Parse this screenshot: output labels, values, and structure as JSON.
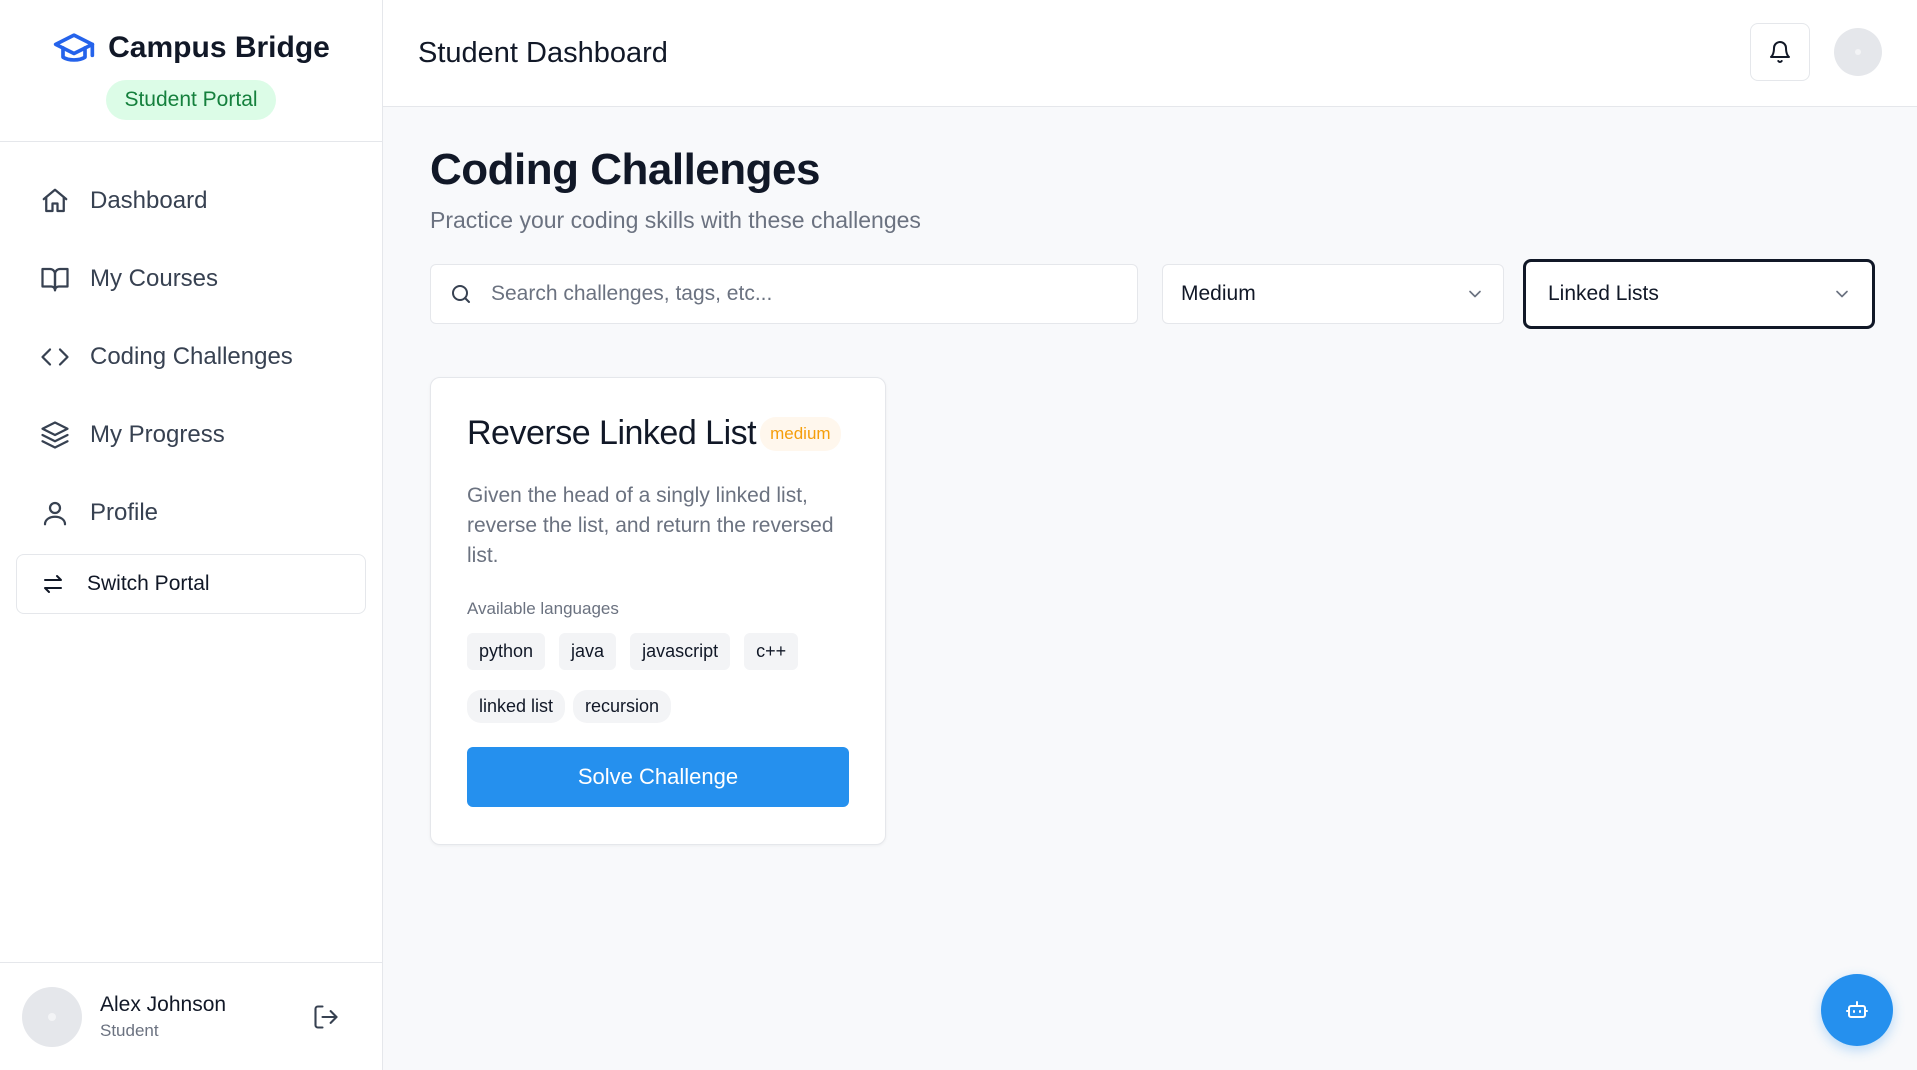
{
  "sidebar": {
    "brand": "Campus Bridge",
    "portal_badge": "Student Portal",
    "items": [
      {
        "label": "Dashboard",
        "icon": "home-icon"
      },
      {
        "label": "My Courses",
        "icon": "book-icon"
      },
      {
        "label": "Coding Challenges",
        "icon": "code-icon"
      },
      {
        "label": "My Progress",
        "icon": "layers-icon"
      },
      {
        "label": "Profile",
        "icon": "user-icon"
      }
    ],
    "switch_label": "Switch Portal",
    "user": {
      "name": "Alex Johnson",
      "role": "Student"
    }
  },
  "header": {
    "title": "Student Dashboard"
  },
  "main": {
    "title": "Coding Challenges",
    "subtitle": "Practice your coding skills with these challenges",
    "search_placeholder": "Search challenges, tags, etc...",
    "difficulty_value": "Medium",
    "topic_value": "Linked Lists"
  },
  "card": {
    "title": "Reverse Linked List",
    "difficulty": "medium",
    "description": "Given the head of a singly linked list, reverse the list, and return the reversed list.",
    "languages_label": "Available languages",
    "languages": [
      "python",
      "java",
      "javascript",
      "c++"
    ],
    "tags": [
      "linked list",
      "recursion"
    ],
    "button": "Solve Challenge"
  },
  "colors": {
    "primary": "#2590ee",
    "badge_green_bg": "#dcfce7",
    "badge_green_text": "#15803d",
    "medium_text": "#f59e0b"
  }
}
